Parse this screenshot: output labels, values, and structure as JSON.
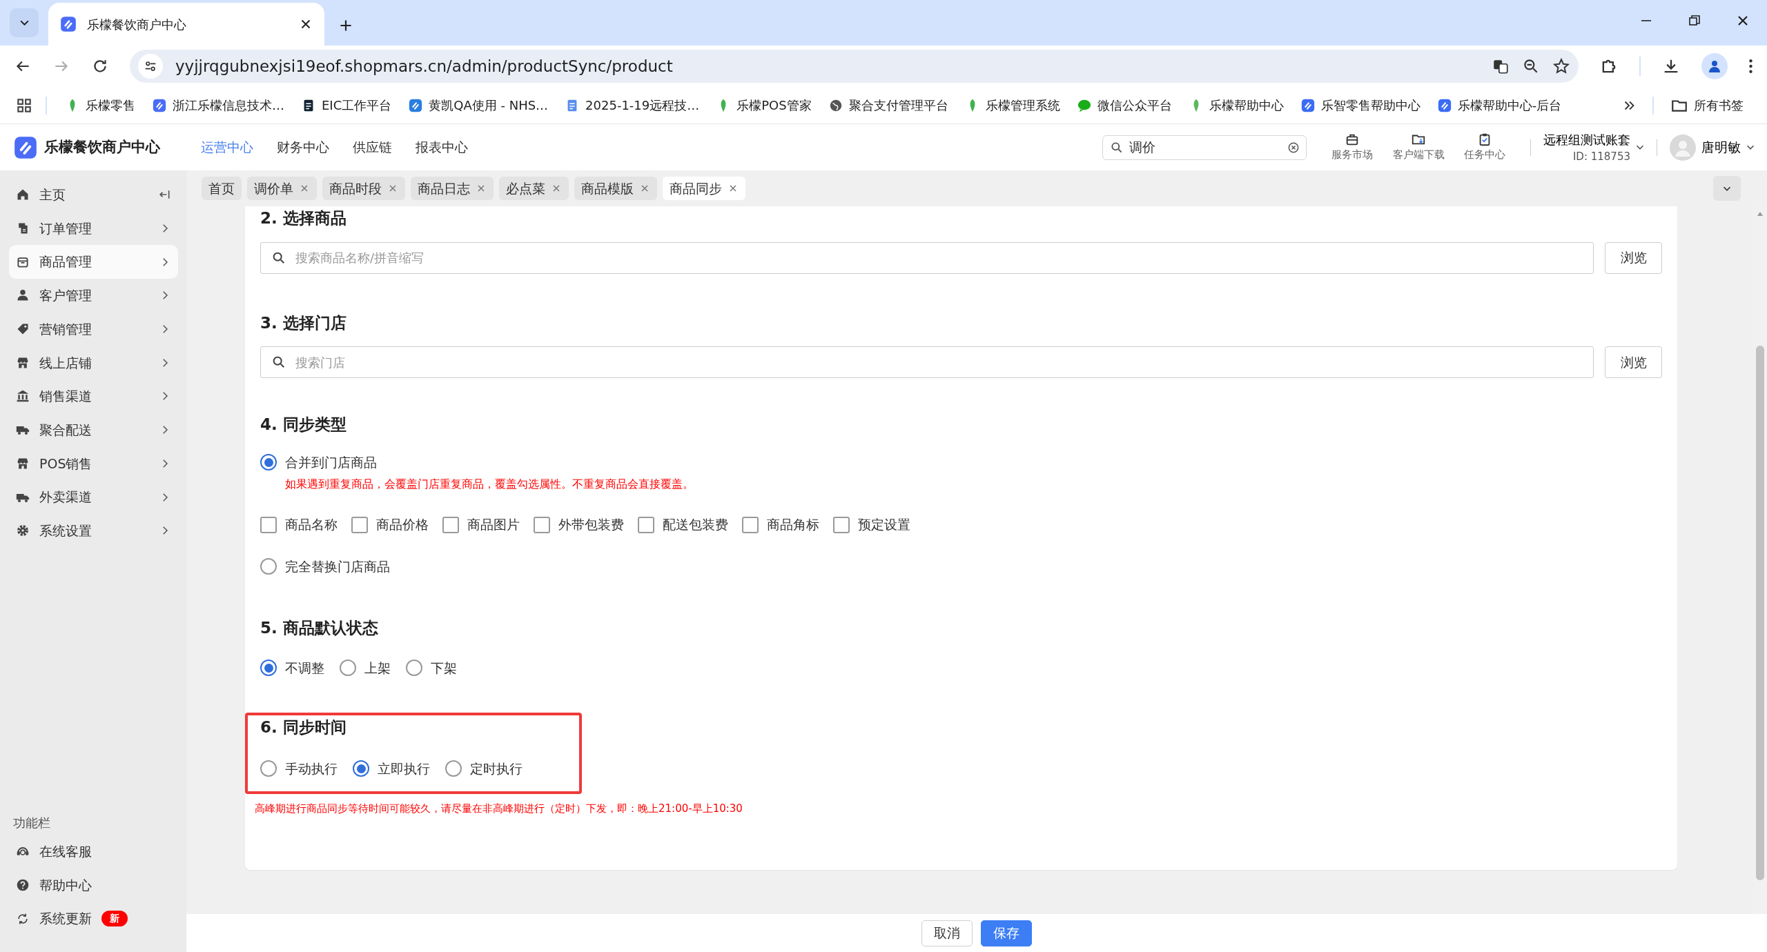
{
  "browser": {
    "tab_title": "乐檬餐饮商户中心",
    "url": "yyjjrqgubnexjsi19eof.shopmars.cn/admin/productSync/product",
    "bookmarks": [
      {
        "label": "乐檬零售"
      },
      {
        "label": "浙江乐檬信息技术…"
      },
      {
        "label": "EIC工作平台"
      },
      {
        "label": "黄凯QA使用 - NHS…"
      },
      {
        "label": "2025-1-19远程技…"
      },
      {
        "label": "乐檬POS管家"
      },
      {
        "label": "聚合支付管理平台"
      },
      {
        "label": "乐檬管理系统"
      },
      {
        "label": "微信公众平台"
      },
      {
        "label": "乐檬帮助中心"
      },
      {
        "label": "乐智零售帮助中心"
      },
      {
        "label": "乐檬帮助中心-后台"
      }
    ],
    "all_bookmarks": "所有书签"
  },
  "header": {
    "brand": "乐檬餐饮商户中心",
    "nav": [
      {
        "label": "运营中心",
        "selected": true
      },
      {
        "label": "财务中心",
        "selected": false
      },
      {
        "label": "供应链",
        "selected": false
      },
      {
        "label": "报表中心",
        "selected": false
      }
    ],
    "search": {
      "value": "调价"
    },
    "tools": [
      {
        "label": "服务市场"
      },
      {
        "label": "客户端下载"
      },
      {
        "label": "任务中心"
      }
    ],
    "account": {
      "name": "远程组测试账套",
      "id": "ID: 118753"
    },
    "user": {
      "name": "唐明敏"
    }
  },
  "page_tabs": [
    {
      "label": "首页",
      "selected": false,
      "closable": false
    },
    {
      "label": "调价单",
      "selected": false,
      "closable": true
    },
    {
      "label": "商品时段",
      "selected": false,
      "closable": true
    },
    {
      "label": "商品日志",
      "selected": false,
      "closable": true
    },
    {
      "label": "必点菜",
      "selected": false,
      "closable": true
    },
    {
      "label": "商品模版",
      "selected": false,
      "closable": true
    },
    {
      "label": "商品同步",
      "selected": true,
      "closable": true
    }
  ],
  "sidebar": {
    "items": [
      {
        "label": "主页",
        "selected": false
      },
      {
        "label": "订单管理",
        "selected": false
      },
      {
        "label": "商品管理",
        "selected": true
      },
      {
        "label": "客户管理",
        "selected": false
      },
      {
        "label": "营销管理",
        "selected": false
      },
      {
        "label": "线上店铺",
        "selected": false
      },
      {
        "label": "销售渠道",
        "selected": false
      },
      {
        "label": "聚合配送",
        "selected": false
      },
      {
        "label": "POS销售",
        "selected": false
      },
      {
        "label": "外卖渠道",
        "selected": false
      },
      {
        "label": "系统设置",
        "selected": false
      }
    ],
    "section_label": "功能栏",
    "tools": [
      {
        "label": "在线客服"
      },
      {
        "label": "帮助中心"
      },
      {
        "label": "系统更新",
        "badge": "新"
      }
    ]
  },
  "form": {
    "select_product": {
      "title": "2. 选择商品",
      "placeholder": "搜索商品名称/拼音缩写",
      "button": "浏览"
    },
    "select_store": {
      "title": "3. 选择门店",
      "placeholder": "搜索门店",
      "button": "浏览"
    },
    "sync_type": {
      "title": "4. 同步类型",
      "merge": {
        "label": "合并到门店商品",
        "selected": true,
        "note": "如果遇到重复商品，会覆盖门店重复商品，覆盖勾选属性。不重复商品会直接覆盖。",
        "fields": [
          {
            "label": "商品名称",
            "checked": false
          },
          {
            "label": "商品价格",
            "checked": false
          },
          {
            "label": "商品图片",
            "checked": false
          },
          {
            "label": "外带包装费",
            "checked": false
          },
          {
            "label": "配送包装费",
            "checked": false
          },
          {
            "label": "商品角标",
            "checked": false
          },
          {
            "label": "预定设置",
            "checked": false
          }
        ]
      },
      "replace": {
        "label": "完全替换门店商品",
        "selected": false
      }
    },
    "default_status": {
      "title": "5. 商品默认状态",
      "options": [
        {
          "label": "不调整",
          "selected": true
        },
        {
          "label": "上架",
          "selected": false
        },
        {
          "label": "下架",
          "selected": false
        }
      ]
    },
    "sync_time": {
      "title": "6. 同步时间",
      "highlighted": true,
      "options": [
        {
          "label": "手动执行",
          "selected": false
        },
        {
          "label": "立即执行",
          "selected": true
        },
        {
          "label": "定时执行",
          "selected": false
        }
      ],
      "note": "高峰期进行商品同步等待时间可能较久，请尽量在非高峰期进行（定时）下发，即：晚上21:00-早上10:30"
    }
  },
  "footer": {
    "buttons": [
      {
        "label": "取消",
        "kind": "secondary"
      },
      {
        "label": "保存",
        "kind": "primary"
      }
    ]
  }
}
